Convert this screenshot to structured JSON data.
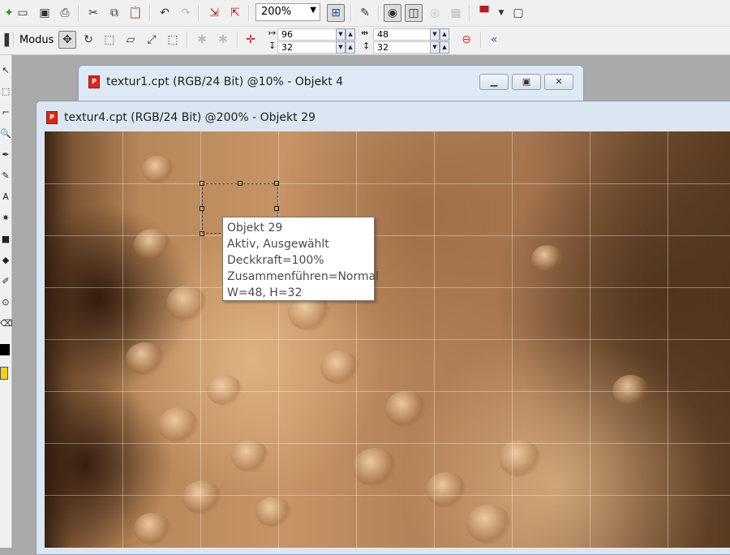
{
  "toolbar": {
    "zoom_value": "200%",
    "icons": [
      "new-icon",
      "open-icon",
      "save-icon",
      "print-icon",
      "cut-icon",
      "copy-icon",
      "paste-icon",
      "undo-icon",
      "redo-icon",
      "import-icon",
      "export-icon",
      "zoom-fit-icon",
      "brush-icon",
      "view-eye-icon",
      "view-mode-icon",
      "disabled-tool-icon",
      "disabled-tool2-icon",
      "launcher-icon",
      "dropdown-icon",
      "window-icon"
    ]
  },
  "property_bar": {
    "mode_label": "Modus",
    "x_value": "96",
    "y_value": "32",
    "width_value": "48",
    "height_value": "32"
  },
  "windows": {
    "back": {
      "title": "textur1.cpt (RGB/24 Bit) @10% - Objekt 4"
    },
    "front": {
      "title": "textur4.cpt (RGB/24 Bit) @200% - Objekt 29"
    }
  },
  "tooltip": {
    "lines": [
      "Objekt 29",
      "Aktiv, Ausgewählt",
      "Deckkraft=100%",
      "Zusammenführen=Normal",
      "W=48, H=32"
    ]
  },
  "colors": {
    "toolbar_bg": "#f0f0f0",
    "window_frame": "#dfe9f5",
    "close_accent": "#d52a1a",
    "texture_mid": "#c69466"
  }
}
